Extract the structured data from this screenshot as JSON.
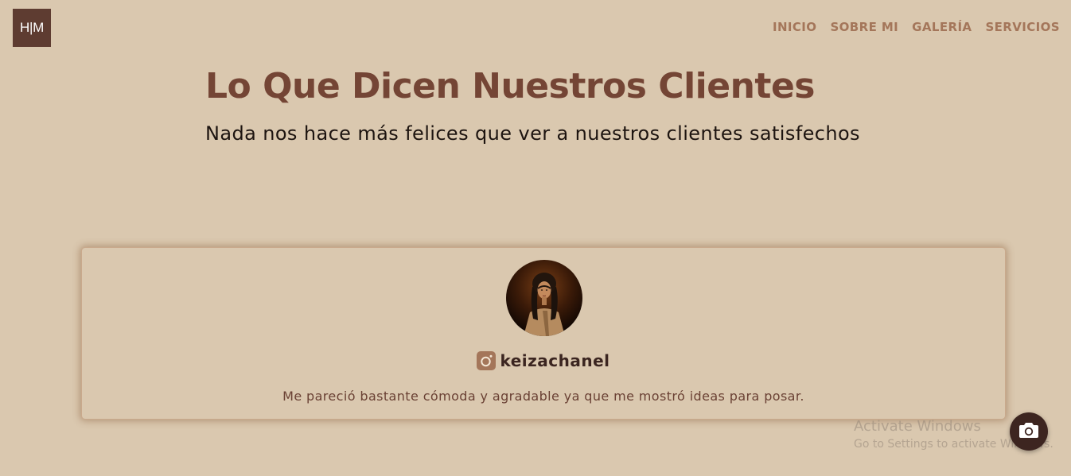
{
  "brand": {
    "logo_text": "H|M"
  },
  "nav": {
    "items": [
      {
        "label": "INICIO"
      },
      {
        "label": "SOBRE MI"
      },
      {
        "label": "GALERÍA"
      },
      {
        "label": "SERVICIOS"
      }
    ]
  },
  "testimonials": {
    "title": "Lo Que Dicen Nuestros Clientes",
    "subtitle": "Nada nos hace más felices que ver a nuestros clientes satisfechos",
    "card": {
      "social_icon": "instagram-icon",
      "handle": "keizachanel",
      "quote": "Me pareció bastante cómoda y agradable ya que me mostró ideas para posar."
    }
  },
  "windows_watermark": {
    "title": "Activate Windows",
    "subtitle": "Go to Settings to activate Windows."
  },
  "floating_action": {
    "icon": "camera-icon"
  },
  "colors": {
    "background": "#dac8af",
    "logo_bg": "#5e3c31",
    "nav_text": "#a4765a",
    "title": "#744535",
    "handle": "#3b2520",
    "quote": "#6a4134",
    "instagram_icon": "#a4765a",
    "camera_button": "#3d2520"
  }
}
